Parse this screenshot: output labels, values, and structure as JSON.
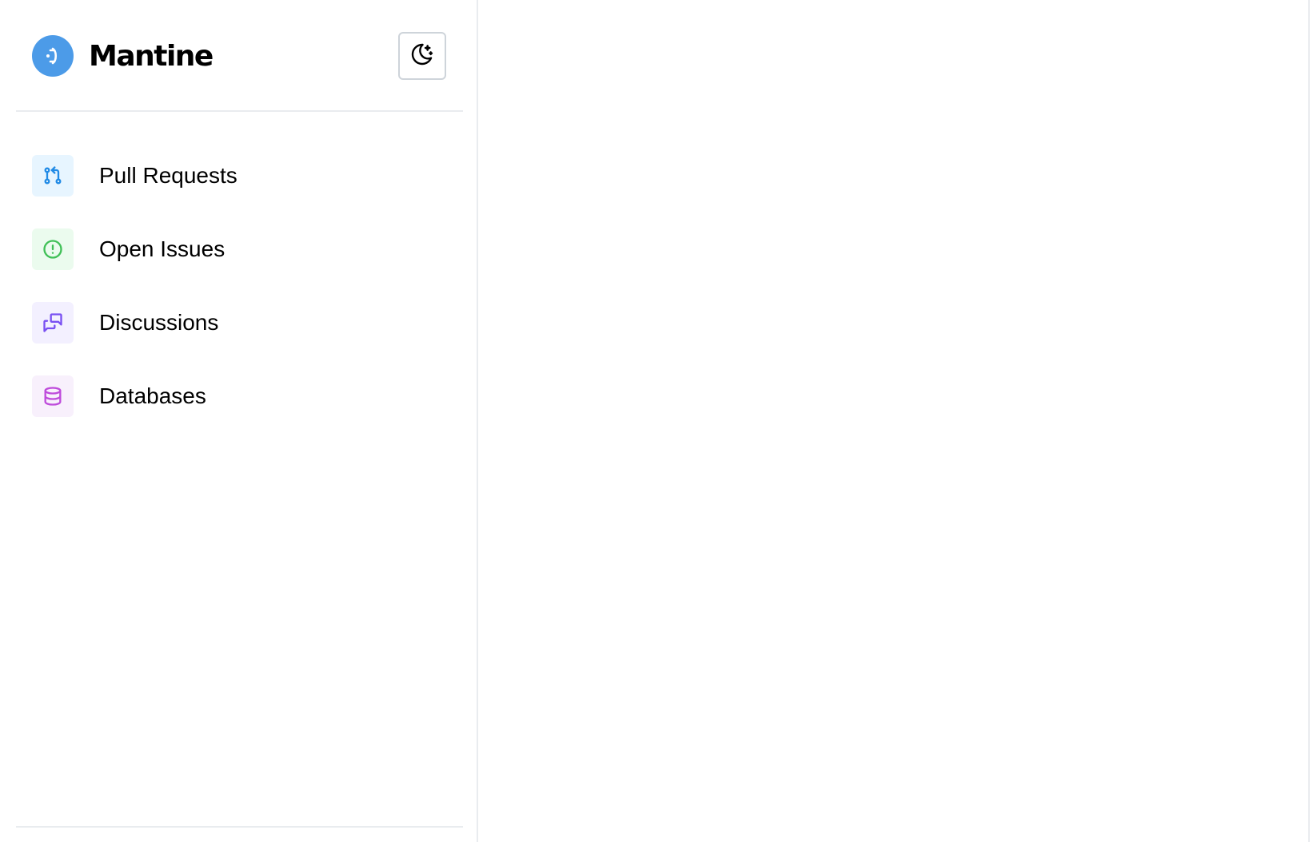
{
  "app": {
    "brand_name": "Mantine",
    "brand_color": "#4c9be8",
    "logo_icon": "mantine-logo-icon"
  },
  "header": {
    "theme_toggle_icon": "moon-stars-icon"
  },
  "sidebar": {
    "items": [
      {
        "label": "Pull Requests",
        "icon": "git-pull-request-icon",
        "color": "#228be6",
        "bg": "#e7f5ff"
      },
      {
        "label": "Open Issues",
        "icon": "alert-circle-icon",
        "color": "#40c057",
        "bg": "#ebfbee"
      },
      {
        "label": "Discussions",
        "icon": "messages-icon",
        "color": "#7950f2",
        "bg": "#f3f0ff"
      },
      {
        "label": "Databases",
        "icon": "database-icon",
        "color": "#be4bdb",
        "bg": "#f8f0fc"
      }
    ]
  }
}
